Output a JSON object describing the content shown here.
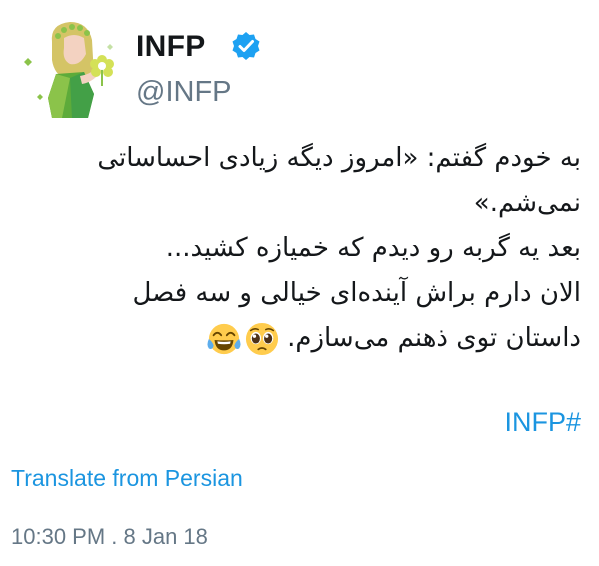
{
  "author": {
    "display_name": "INFP",
    "handle": "@INFP",
    "verified": true,
    "avatar_icon": "woman-with-flower-illustration"
  },
  "tweet": {
    "lines": [
      "به خودم گفتم: «امروز دیگه زیادی احساساتی",
      "نمی‌شم.»",
      "بعد یه گربه رو دیدم که خمیازه کشید...",
      "الان دارم براش آینده‌ای خیالی و سه فصل",
      "داستان توی ذهنم می‌سازم."
    ],
    "emojis": [
      "pleading-face-icon",
      "tears-of-joy-icon"
    ],
    "hashtag": "INFP#"
  },
  "translate_link": "Translate from Persian",
  "timestamp": "10:30 PM . 8 Jan 18",
  "colors": {
    "link": "#1b95e0",
    "secondary_text": "#657786",
    "primary_text": "#14171a",
    "avatar_green": "#8bc34a"
  }
}
